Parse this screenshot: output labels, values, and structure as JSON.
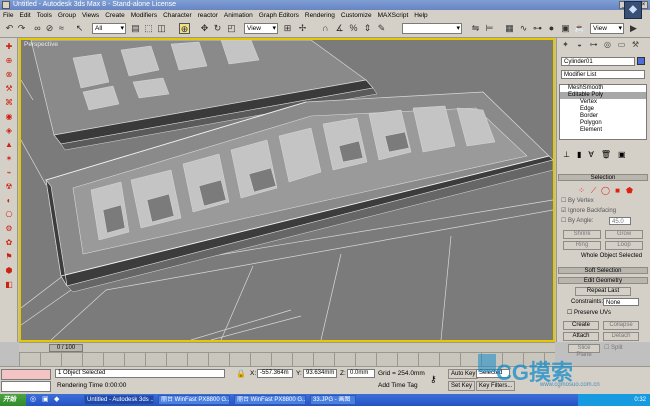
{
  "window": {
    "title": "Untitled - Autodesk 3ds Max 8 - Stand-alone License",
    "buttons": [
      "_",
      "□",
      "×"
    ]
  },
  "menu": [
    "File",
    "Edit",
    "Tools",
    "Group",
    "Views",
    "Create",
    "Modifiers",
    "Character",
    "reactor",
    "Animation",
    "Graph Editors",
    "Rendering",
    "Customize",
    "MAXScript",
    "Help"
  ],
  "toolbar": {
    "selection_filter": "All",
    "ref_coord": "View",
    "named_selection": "",
    "view_right": "View"
  },
  "viewport": {
    "label": "Perspective"
  },
  "command_panel": {
    "object_name": "Cylinder01",
    "modifier_list": "Modifier List",
    "stack": [
      {
        "label": "MeshSmooth",
        "selected": false,
        "sub": false
      },
      {
        "label": "Editable Poly",
        "selected": true,
        "sub": false
      },
      {
        "label": "Vertex",
        "selected": false,
        "sub": true
      },
      {
        "label": "Edge",
        "selected": false,
        "sub": true
      },
      {
        "label": "Border",
        "selected": false,
        "sub": true
      },
      {
        "label": "Polygon",
        "selected": false,
        "sub": true
      },
      {
        "label": "Element",
        "selected": false,
        "sub": true
      }
    ],
    "rollouts": {
      "selection": "Selection",
      "soft_selection": "Soft Selection",
      "edit_geometry": "Edit Geometry"
    },
    "selection": {
      "by_vertex": "By Vertex",
      "ignore_backfacing": "Ignore Backfacing",
      "by_angle": "By Angle:",
      "by_angle_value": "45.0",
      "shrink": "Shrink",
      "grow": "Grow",
      "ring": "Ring",
      "loop": "Loop",
      "status": "Whole Object Selected"
    },
    "edit_geometry": {
      "repeat_last": "Repeat Last",
      "constraints_label": "Constraints:",
      "constraints_value": "None",
      "preserve_uvs": "Preserve UVs",
      "create": "Create",
      "collapse": "Collapse",
      "attach": "Attach",
      "detach": "Detach",
      "slice_plane": "Slice Plane",
      "split": "Split"
    }
  },
  "timeline": {
    "slider": "0 / 100"
  },
  "status": {
    "selected": "1 Object Selected",
    "render_time": "Rendering Time  0:00:00",
    "x_label": "X:",
    "x": "-557.364m",
    "y_label": "Y:",
    "y": "93.634mm",
    "z_label": "Z:",
    "z": "0.0mm",
    "grid": "Grid = 254.0mm",
    "add_time_tag": "Add Time Tag",
    "auto_key": "Auto Key",
    "set_key": "Set Key",
    "selected_dropdown": "Selected",
    "key_filters": "Key Filters..."
  },
  "watermark": {
    "text": "CG摸索",
    "url": "www.cgmosuo.com.cn"
  },
  "taskbar": {
    "start": "开始",
    "tasks": [
      {
        "label": "Untitled - Autodesk 3ds ...",
        "active": true
      },
      {
        "label": "丽台 WinFast PX8800 G...",
        "active": false
      },
      {
        "label": "丽台 WinFast PX8800 G...",
        "active": false
      },
      {
        "label": "33.JPG - 画图",
        "active": false
      }
    ],
    "clock": "0:32"
  },
  "colors": {
    "viewport_bg": "#7b7b7b",
    "active_viewport_border": "#e6c800",
    "object_color": "#4f6fd8",
    "taskbar": "#2453c4"
  }
}
